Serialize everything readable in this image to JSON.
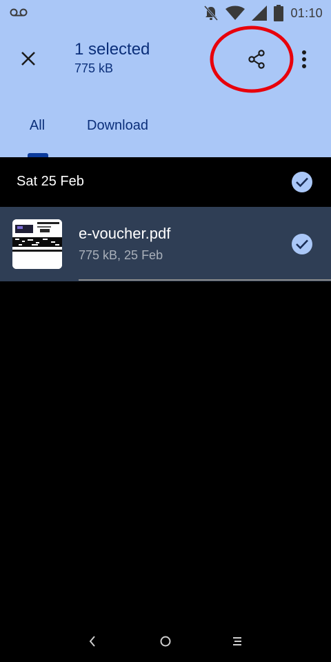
{
  "status_bar": {
    "time": "01:10",
    "icons": [
      "voicemail-icon",
      "notifications-off-icon",
      "wifi-icon",
      "signal-icon",
      "battery-icon"
    ]
  },
  "toolbar": {
    "title": "1 selected",
    "subtitle": "775 kB",
    "close_icon": "close-icon",
    "share_icon": "share-icon",
    "more_icon": "more-vert-icon"
  },
  "tabs": [
    {
      "label": "All",
      "selected": true
    },
    {
      "label": "Download",
      "selected": false
    }
  ],
  "list": {
    "date_header": "Sat 25 Feb",
    "date_selected": true,
    "files": [
      {
        "name": "e-voucher.pdf",
        "meta": "775 kB, 25 Feb",
        "selected": true
      }
    ]
  },
  "nav": {
    "back": "‹",
    "home": "○",
    "recents": "☰"
  },
  "colors": {
    "header_bg": "#aac7f7",
    "header_text": "#0b2f7a",
    "selected_row_bg": "#2f3e55",
    "annotation": "#e8000b"
  }
}
